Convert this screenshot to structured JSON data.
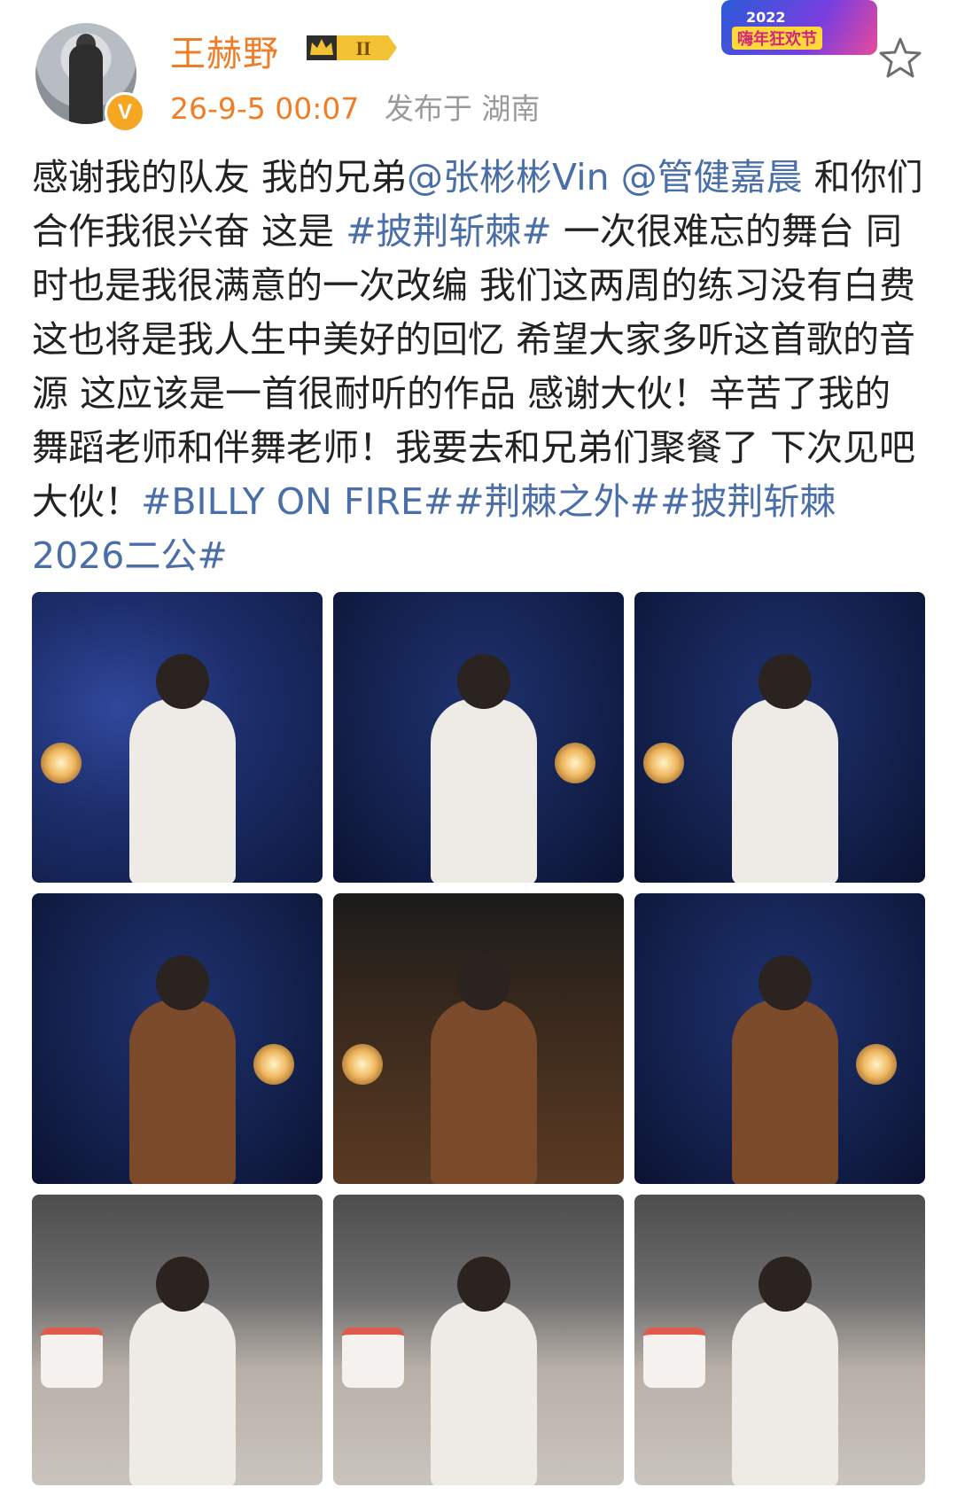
{
  "header": {
    "username": "王赫野",
    "vip_level": "II",
    "timestamp": "26-9-5 00:07",
    "location": "发布于 湖南",
    "banner_year": "2022",
    "banner_label": "嗨年狂欢节",
    "avatar_badge": "V",
    "favorite_icon": "star-outline-icon"
  },
  "post": {
    "segments": [
      {
        "text": "感谢我的队友 我的兄弟",
        "type": "text"
      },
      {
        "text": "@张彬彬Vin",
        "type": "mention"
      },
      {
        "text": " ",
        "type": "text"
      },
      {
        "text": "@管健嘉晨",
        "type": "mention"
      },
      {
        "text": " 和你们合作我很兴奋 这是 ",
        "type": "text"
      },
      {
        "text": "#披荆斩棘#",
        "type": "hashtag"
      },
      {
        "text": " 一次很难忘的舞台 同时也是我很满意的一次改编 我们这两周的练习没有白费 这也将是我人生中美好的回忆 希望大家多听这首歌的音源 这应该是一首很耐听的作品 感谢大伙！辛苦了我的舞蹈老师和伴舞老师！我要去和兄弟们聚餐了 下次见吧大伙！",
        "type": "text"
      },
      {
        "text": "#BILLY ON FIRE#",
        "type": "hashtag"
      },
      {
        "text": "#荆棘之外#",
        "type": "hashtag"
      },
      {
        "text": "#披荆斩棘2026二公#",
        "type": "hashtag"
      }
    ]
  },
  "photos": [
    {
      "name": "photo-1",
      "style": "p-stage-blue"
    },
    {
      "name": "photo-2",
      "style": "p-stage-dark"
    },
    {
      "name": "photo-3",
      "style": "p-stage-dark"
    },
    {
      "name": "photo-4",
      "style": "p-stage-dark"
    },
    {
      "name": "photo-5",
      "style": "p-studio"
    },
    {
      "name": "photo-6",
      "style": "p-stage-dark"
    },
    {
      "name": "photo-7",
      "style": "p-lounge"
    },
    {
      "name": "photo-8",
      "style": "p-lounge"
    },
    {
      "name": "photo-9",
      "style": "p-lounge"
    }
  ],
  "colors": {
    "username": "#f07d26",
    "link": "#4a6ea7",
    "meta": "#9a9a9a",
    "body_text": "#222222"
  }
}
